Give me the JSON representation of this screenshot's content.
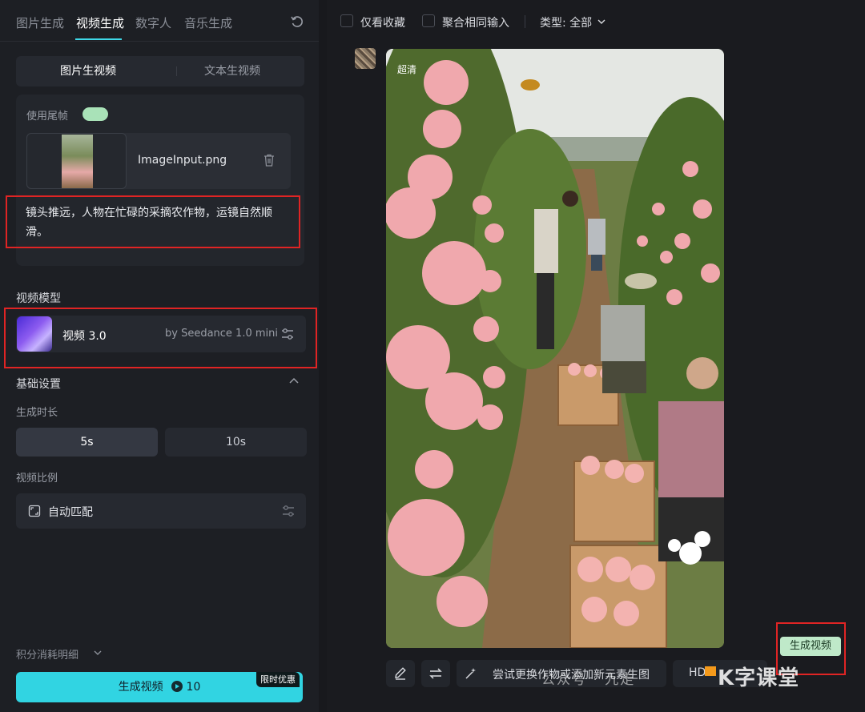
{
  "tabs": [
    "图片生成",
    "视频生成",
    "数字人",
    "音乐生成"
  ],
  "mode_segment": [
    "图片生视频",
    "文本生视频"
  ],
  "use_tail_frame_label": "使用尾帧",
  "image_input": {
    "filename": "ImageInput.png"
  },
  "prompt": "镜头推远，人物在忙碌的采摘农作物，运镜自然顺滑。",
  "video_model": {
    "section_label": "视频模型",
    "name": "视频 3.0",
    "by": "by Seedance 1.0 mini"
  },
  "basic_settings": {
    "label": "基础设置",
    "duration_label": "生成时长",
    "durations": [
      "5s",
      "10s"
    ],
    "ratio_label": "视频比例",
    "ratio_value": "自动匹配"
  },
  "credits_label": "积分消耗明细",
  "generate": {
    "label": "生成视频",
    "cost": "10",
    "promo": "限时优惠"
  },
  "filters": {
    "favorites_only": "仅看收藏",
    "merge_same_input": "聚合相同输入",
    "type_label": "类型: 全部"
  },
  "result": {
    "quality_badge": "超清",
    "generate_video_button": "生成视频",
    "suggest_text": "尝试更换作物或添加新元素生图",
    "hd_button_label": "HD"
  },
  "watermark": {
    "text1": "公众号 · 九走",
    "text2": "K字课堂"
  },
  "colors": {
    "accent": "#31d4e2",
    "highlight": "#e02424",
    "toggle": "#a9e2b8"
  }
}
